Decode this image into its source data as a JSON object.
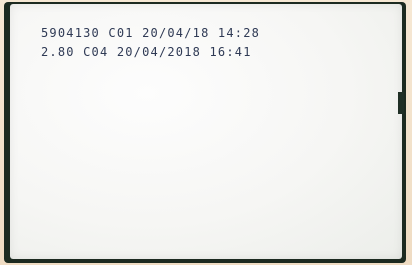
{
  "ticket": {
    "line1": "5904130 C01 20/04/18 14:28",
    "line2": "2.80 C04 20/04/2018 16:41"
  }
}
